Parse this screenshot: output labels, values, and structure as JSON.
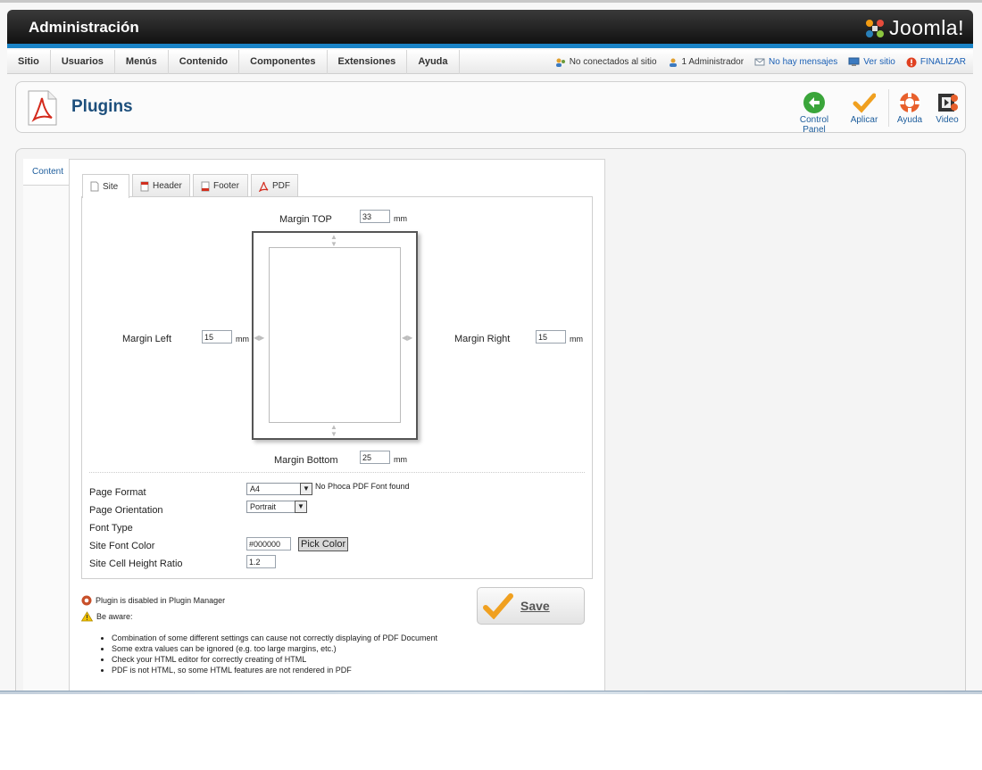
{
  "header": {
    "title": "Administración",
    "brand": "Joomla!"
  },
  "menu": {
    "items": [
      "Sitio",
      "Usuarios",
      "Menús",
      "Contenido",
      "Componentes",
      "Extensiones",
      "Ayuda"
    ]
  },
  "status": {
    "not_connected": "No conectados al sitio",
    "admins": "1 Administrador",
    "messages": "No hay mensajes",
    "view_site": "Ver sitio",
    "logout": "FINALIZAR"
  },
  "page": {
    "title": "Plugins"
  },
  "toolbar": {
    "control_panel": "Control Panel",
    "apply": "Aplicar",
    "help": "Ayuda",
    "video": "Video"
  },
  "side": {
    "content_tab": "Content"
  },
  "tabs": [
    "Site",
    "Header",
    "Footer",
    "PDF"
  ],
  "margins": {
    "top_label": "Margin TOP",
    "top_value": "33",
    "left_label": "Margin Left",
    "left_value": "15",
    "right_label": "Margin Right",
    "right_value": "15",
    "bottom_label": "Margin Bottom",
    "bottom_value": "25",
    "unit": "mm"
  },
  "settings": {
    "page_format_label": "Page Format",
    "page_format_value": "A4",
    "font_note": "No Phoca PDF Font found",
    "orientation_label": "Page Orientation",
    "orientation_value": "Portrait",
    "font_type_label": "Font Type",
    "font_color_label": "Site Font Color",
    "font_color_value": "#000000",
    "pick_color": "Pick Color",
    "cell_ratio_label": "Site Cell Height Ratio",
    "cell_ratio_value": "1.2"
  },
  "save_label": "Save",
  "notes": {
    "disabled": "Plugin is disabled in Plugin Manager",
    "aware": "Be aware:",
    "bullets": [
      "Combination of some different settings can cause not correctly displaying of PDF Document",
      "Some extra values can be ignored (e.g. too large margins, etc.)",
      "Check your HTML editor for correctly creating of HTML",
      "PDF is not HTML, so some HTML features are not rendered in PDF"
    ]
  },
  "colors": {
    "accent_blue": "#1a83c6",
    "title_blue": "#1d4f7c",
    "header_dark": "#1a1a1a"
  }
}
